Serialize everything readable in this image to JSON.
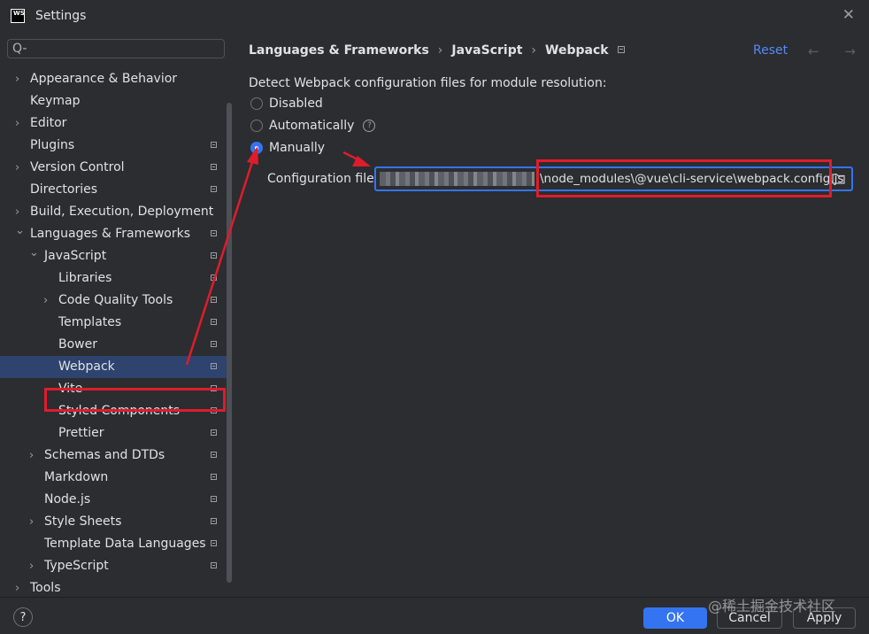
{
  "window": {
    "app_icon": "WS",
    "title": "Settings"
  },
  "search": {
    "placeholder": "Q-"
  },
  "tree": [
    {
      "label": "Appearance & Behavior",
      "expandable": true,
      "expanded": false,
      "level": 0,
      "bookmark": false
    },
    {
      "label": "Keymap",
      "expandable": false,
      "level": 0,
      "bookmark": false
    },
    {
      "label": "Editor",
      "expandable": true,
      "expanded": false,
      "level": 0,
      "bookmark": false
    },
    {
      "label": "Plugins",
      "expandable": false,
      "level": 0,
      "bookmark": true
    },
    {
      "label": "Version Control",
      "expandable": true,
      "expanded": false,
      "level": 0,
      "bookmark": true
    },
    {
      "label": "Directories",
      "expandable": false,
      "level": 0,
      "bookmark": true
    },
    {
      "label": "Build, Execution, Deployment",
      "expandable": true,
      "expanded": false,
      "level": 0,
      "bookmark": false
    },
    {
      "label": "Languages & Frameworks",
      "expandable": true,
      "expanded": true,
      "level": 0,
      "bookmark": true
    },
    {
      "label": "JavaScript",
      "expandable": true,
      "expanded": true,
      "level": 1,
      "bookmark": true
    },
    {
      "label": "Libraries",
      "expandable": false,
      "level": 2,
      "bookmark": true
    },
    {
      "label": "Code Quality Tools",
      "expandable": true,
      "expanded": false,
      "level": 2,
      "bookmark": true
    },
    {
      "label": "Templates",
      "expandable": false,
      "level": 2,
      "bookmark": true
    },
    {
      "label": "Bower",
      "expandable": false,
      "level": 2,
      "bookmark": true
    },
    {
      "label": "Webpack",
      "expandable": false,
      "level": 2,
      "bookmark": true,
      "selected": true
    },
    {
      "label": "Vite",
      "expandable": false,
      "level": 2,
      "bookmark": true
    },
    {
      "label": "Styled Components",
      "expandable": false,
      "level": 2,
      "bookmark": true
    },
    {
      "label": "Prettier",
      "expandable": false,
      "level": 2,
      "bookmark": true
    },
    {
      "label": "Schemas and DTDs",
      "expandable": true,
      "expanded": false,
      "level": 1,
      "bookmark": true
    },
    {
      "label": "Markdown",
      "expandable": false,
      "level": 1,
      "bookmark": true
    },
    {
      "label": "Node.js",
      "expandable": false,
      "level": 1,
      "bookmark": true
    },
    {
      "label": "Style Sheets",
      "expandable": true,
      "expanded": false,
      "level": 1,
      "bookmark": true
    },
    {
      "label": "Template Data Languages",
      "expandable": false,
      "level": 1,
      "bookmark": true
    },
    {
      "label": "TypeScript",
      "expandable": true,
      "expanded": false,
      "level": 1,
      "bookmark": true
    },
    {
      "label": "Tools",
      "expandable": true,
      "expanded": false,
      "level": 0,
      "bookmark": false
    }
  ],
  "breadcrumb": [
    "Languages & Frameworks",
    "JavaScript",
    "Webpack"
  ],
  "reset_label": "Reset",
  "nav_arrows": "← →",
  "detect_label": "Detect Webpack configuration files for module resolution:",
  "options": {
    "disabled": "Disabled",
    "automatically": "Automatically",
    "manually": "Manually",
    "selected": "manually"
  },
  "config": {
    "label": "Configuration file:",
    "value_visible": "\\node_modules\\@vue\\cli-service\\webpack.config.js"
  },
  "footer": {
    "help": "?",
    "ok": "OK",
    "cancel": "Cancel",
    "apply": "Apply"
  },
  "watermark": "@稀土掘金技术社区",
  "colors": {
    "accent": "#3574f0",
    "annotation": "#e01c2c",
    "selection": "#2e436e",
    "background": "#2b2d30"
  }
}
